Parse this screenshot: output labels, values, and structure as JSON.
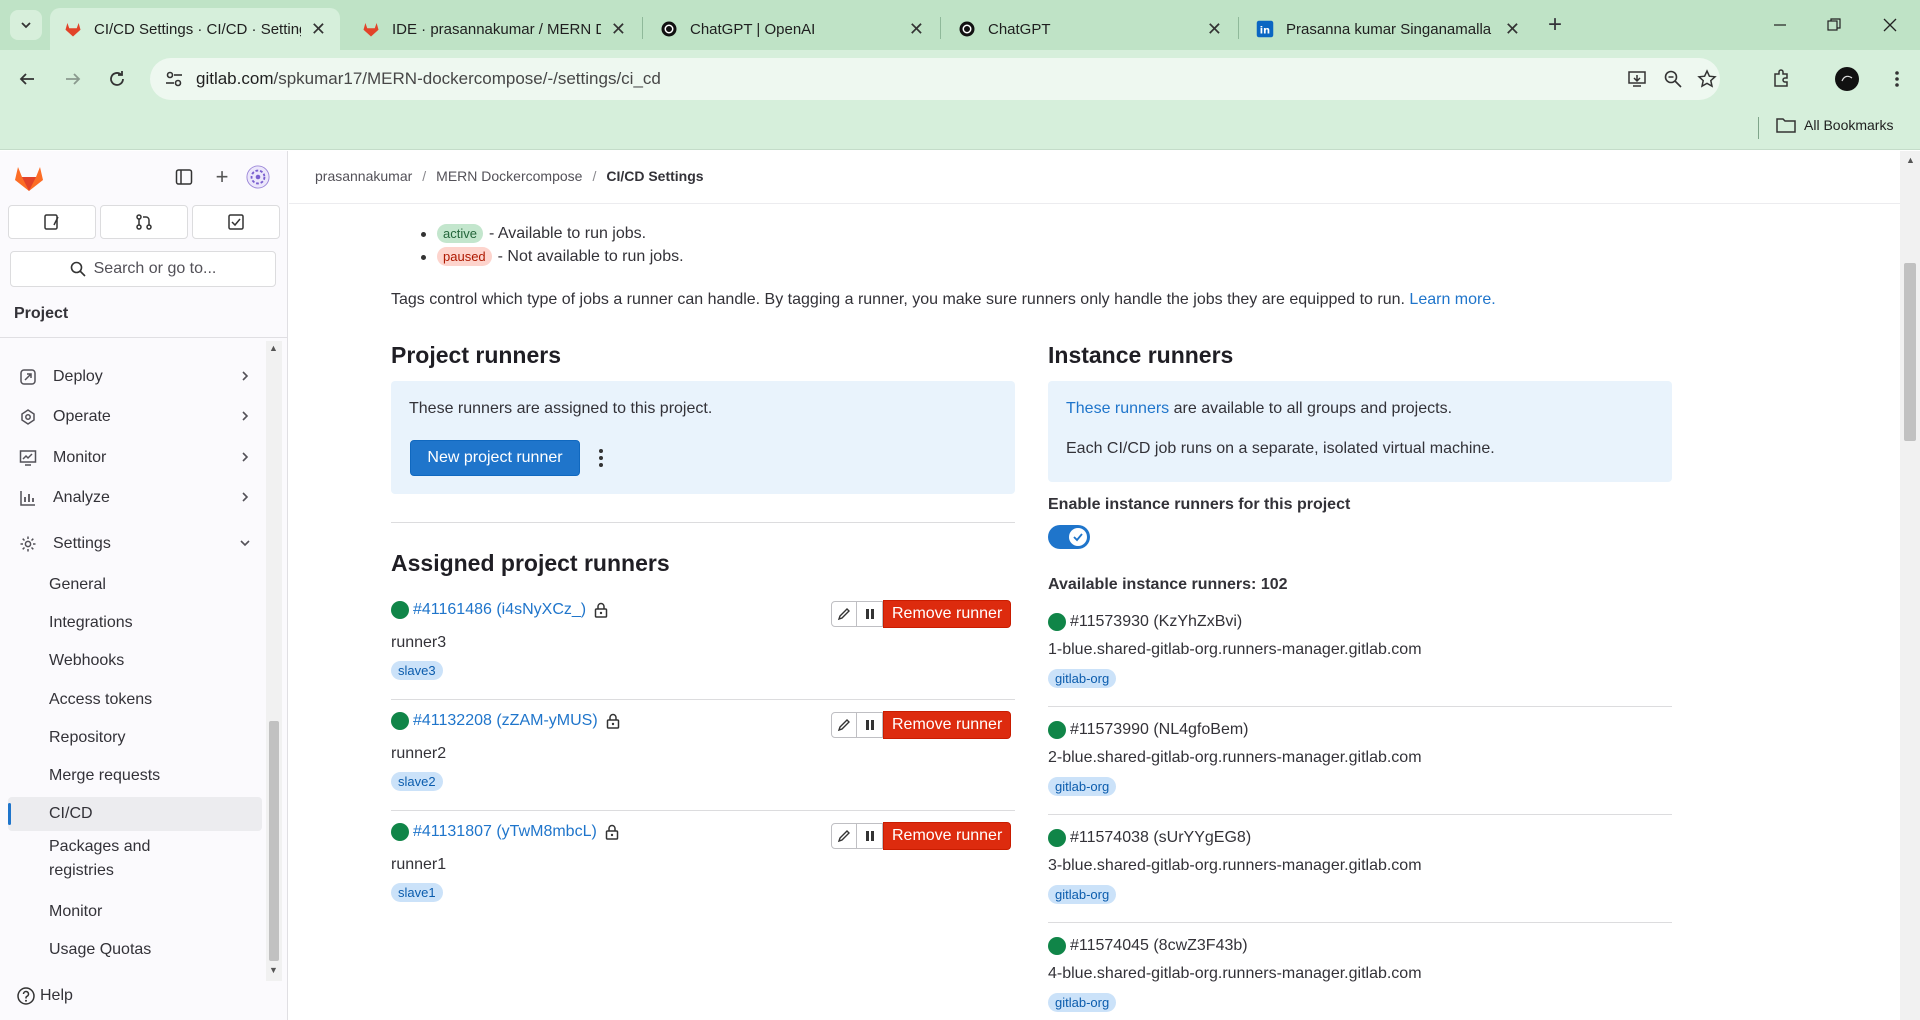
{
  "browser": {
    "tabs": [
      {
        "title": "CI/CD Settings · CI/CD · Settings",
        "icon": "gitlab-icon",
        "active": true
      },
      {
        "title": "IDE · prasannakumar / MERN D",
        "icon": "gitlab-icon",
        "active": false
      },
      {
        "title": "ChatGPT | OpenAI",
        "icon": "openai-icon",
        "active": false
      },
      {
        "title": "ChatGPT",
        "icon": "openai-icon",
        "active": false
      },
      {
        "title": "Prasanna kumar Singanamalla |",
        "icon": "linkedin-icon",
        "active": false
      }
    ],
    "url_host": "gitlab.com",
    "url_path": "/spkumar17/MERN-dockercompose/-/settings/ci_cd",
    "bookmarks_label": "All Bookmarks"
  },
  "sidebar": {
    "search_placeholder": "Search or go to...",
    "section_title": "Project",
    "items": [
      {
        "label": "Deploy",
        "icon": "rocket-icon"
      },
      {
        "label": "Operate",
        "icon": "cloud-icon"
      },
      {
        "label": "Monitor",
        "icon": "monitor-icon"
      },
      {
        "label": "Analyze",
        "icon": "chart-icon"
      },
      {
        "label": "Settings",
        "icon": "gear-icon"
      }
    ],
    "settings_children": [
      "General",
      "Integrations",
      "Webhooks",
      "Access tokens",
      "Repository",
      "Merge requests",
      "CI/CD",
      "Packages and",
      "registries",
      "Monitor",
      "Usage Quotas"
    ],
    "active_child": "CI/CD",
    "help_label": "Help"
  },
  "breadcrumb": {
    "items": [
      "prasannakumar",
      "MERN Dockercompose",
      "CI/CD Settings"
    ]
  },
  "legend": {
    "active_badge": "active",
    "active_text": "- Available to run jobs.",
    "paused_badge": "paused",
    "paused_text": "- Not available to run jobs.",
    "tags_text": "Tags control which type of jobs a runner can handle. By tagging a runner, you make sure runners only handle the jobs they are equipped to run.",
    "learn_more": "Learn more."
  },
  "project_runners": {
    "title": "Project runners",
    "info": "These runners are assigned to this project.",
    "new_button": "New project runner",
    "assigned_title": "Assigned project runners",
    "remove_label": "Remove runner",
    "runners": [
      {
        "id": "#41161486 (i4sNyXCz_)",
        "name": "runner3",
        "tag": "slave3",
        "status": "online"
      },
      {
        "id": "#41132208 (zZAM-yMUS)",
        "name": "runner2",
        "tag": "slave2",
        "status": "online"
      },
      {
        "id": "#41131807 (yTwM8mbcL)",
        "name": "runner1",
        "tag": "slave1",
        "status": "online"
      }
    ]
  },
  "instance_runners": {
    "title": "Instance runners",
    "info_link": "These runners",
    "info_rest": "are available to all groups and projects.",
    "info_line2": "Each CI/CD job runs on a separate, isolated virtual machine.",
    "toggle_label": "Enable instance runners for this project",
    "toggle_on": true,
    "available_label": "Available instance runners: 102",
    "runners": [
      {
        "id": "#11573930 (KzYhZxBvi)",
        "host": "1-blue.shared-gitlab-org.runners-manager.gitlab.com",
        "tag": "gitlab-org"
      },
      {
        "id": "#11573990 (NL4gfoBem)",
        "host": "2-blue.shared-gitlab-org.runners-manager.gitlab.com",
        "tag": "gitlab-org"
      },
      {
        "id": "#11574038 (sUrYYgEG8)",
        "host": "3-blue.shared-gitlab-org.runners-manager.gitlab.com",
        "tag": "gitlab-org"
      },
      {
        "id": "#11574045 (8cwZ3F43b)",
        "host": "4-blue.shared-gitlab-org.runners-manager.gitlab.com",
        "tag": "gitlab-org"
      }
    ]
  },
  "colors": {
    "accent": "#1f75cb",
    "danger": "#dd2b0e",
    "online": "#108548",
    "browser_frame": "#bfe3c6"
  }
}
